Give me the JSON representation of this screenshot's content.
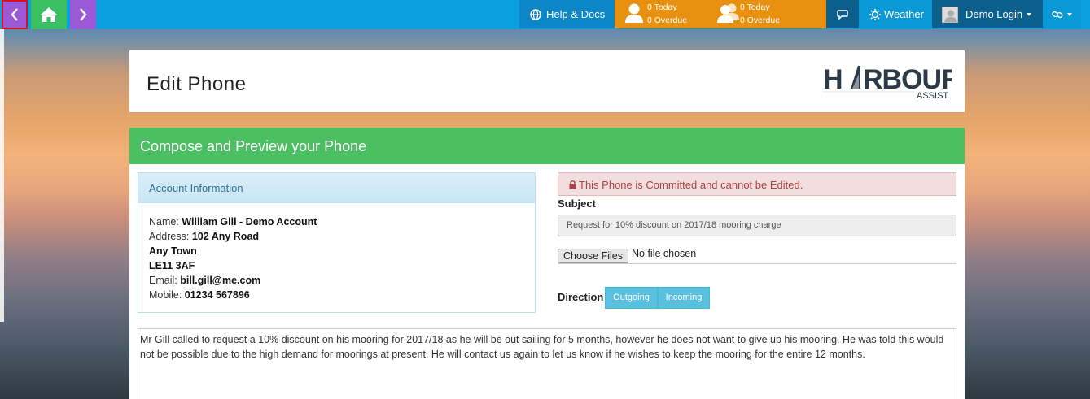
{
  "topbar": {
    "help_label": "Help & Docs",
    "tasks": [
      {
        "today": "0 Today",
        "overdue": "0 Overdue"
      },
      {
        "today": "0 Today",
        "overdue": "0 Overdue"
      }
    ],
    "weather_label": "Weather",
    "user_label": "Demo Login",
    "colors": {
      "bar": "#0aa0e0",
      "nav_purple": "#9b59d8",
      "home_green": "#3bbf63",
      "tasks_orange": "#e8900f",
      "dark": "#0b5f8c"
    }
  },
  "page": {
    "title": "Edit Phone",
    "logo": {
      "brand": "HARBOUR",
      "sub": "ASSIST"
    }
  },
  "compose": {
    "header": "Compose and Preview your Phone",
    "account": {
      "heading": "Account Information",
      "name_label": "Name:",
      "name": "William Gill - Demo Account",
      "address_label": "Address:",
      "address_lines": [
        "102 Any Road",
        "Any Town",
        "LE11 3AF"
      ],
      "email_label": "Email:",
      "email": "bill.gill@me.com",
      "mobile_label": "Mobile:",
      "mobile": "01234 567896"
    },
    "alert": "This Phone is Committed and cannot be Edited.",
    "subject_label": "Subject",
    "subject_value": "Request for 10% discount on 2017/18 mooring charge",
    "file_button": "Choose Files",
    "file_status": "No file chosen",
    "direction_label": "Direction",
    "direction_options": [
      "Outgoing",
      "Incoming"
    ],
    "body_text": "Mr Gill called to request a 10% discount on his mooring for 2017/18 as he will be out sailing for 5 months, however he does not want to give up his mooring.  He was told this would not be possible due to the high demand for moorings at present.  He will contact us again to let us know if he wishes to keep the mooring for the entire 12 months."
  }
}
